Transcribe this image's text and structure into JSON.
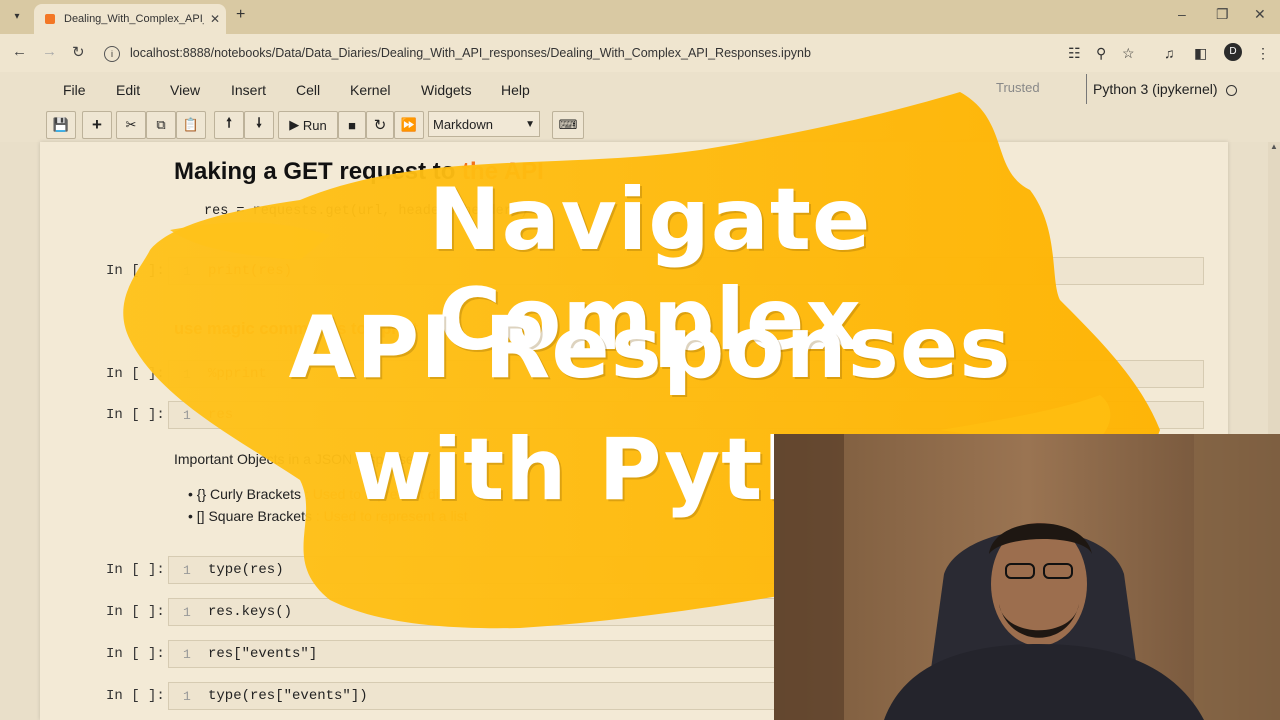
{
  "browser": {
    "tab_title": "Dealing_With_Complex_API_Re",
    "url": "localhost:8888/notebooks/Data/Data_Diaries/Dealing_With_API_responses/Dealing_With_Complex_API_Responses.ipynb",
    "avatar_letter": "D"
  },
  "menu": {
    "items": [
      "File",
      "Edit",
      "View",
      "Insert",
      "Cell",
      "Kernel",
      "Widgets",
      "Help"
    ],
    "trusted": "Trusted",
    "kernel": "Python 3 (ipykernel)"
  },
  "toolbar": {
    "run_label": "Run",
    "cell_type": "Markdown"
  },
  "notebook": {
    "heading_black": "Making a GET request to ",
    "heading_orange": "the API",
    "code_line": "res = requests.get(url, headers=headers)",
    "prompt": "In [ ]:",
    "cells": [
      {
        "ln": "1",
        "src": "print(res)"
      },
      {
        "ln": "1",
        "src": "%pprint"
      },
      {
        "ln": "1",
        "src": "res"
      },
      {
        "ln": "1",
        "src": "type(res)"
      },
      {
        "ln": "1",
        "src": "res.keys()"
      },
      {
        "ln": "1",
        "src": "res[\"events\"]"
      },
      {
        "ln": "1",
        "src": "type(res[\"events\"])"
      }
    ],
    "md_magic": "use magic commands to pprint",
    "para": "Important Objects in a JSON response",
    "bullet1_a": "{} Curly Brackets",
    "bullet1_b": " : Used to represent dict",
    "bullet2_a": "[] Square Brackets",
    "bullet2_b": " : Used to represent a list"
  },
  "banner": {
    "line1": "Navigate Complex",
    "line2": "API Responses",
    "line3": "with Python"
  }
}
